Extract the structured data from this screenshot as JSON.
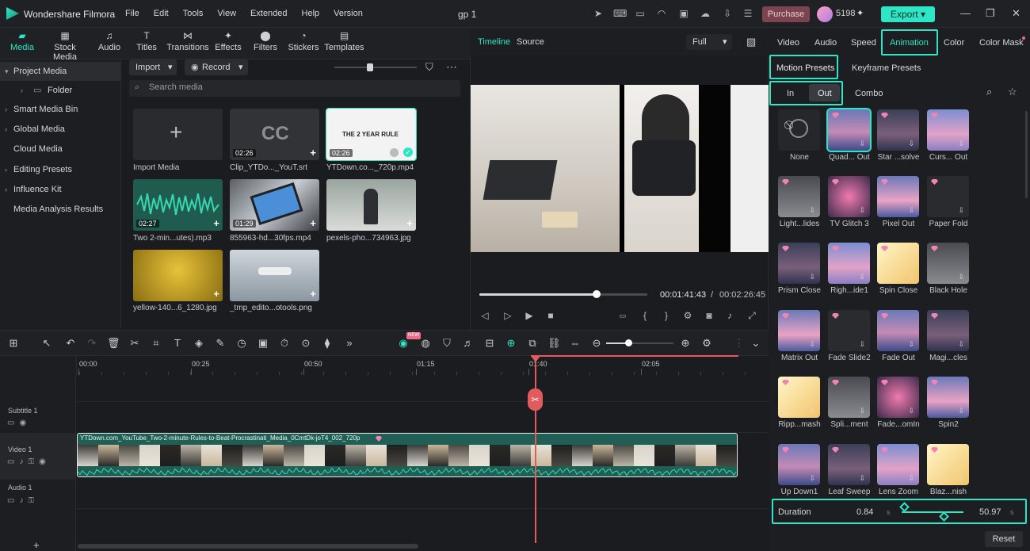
{
  "app": {
    "name": "Wondershare Filmora",
    "project": "gp 1",
    "credits": "5198",
    "purchase": "Purchase",
    "export": "Export"
  },
  "menu": [
    "File",
    "Edit",
    "Tools",
    "View",
    "Extended",
    "Help",
    "Version"
  ],
  "toptabs": [
    {
      "label": "Media",
      "icon": "media-icon"
    },
    {
      "label": "Stock Media",
      "icon": "stock-media-icon"
    },
    {
      "label": "Audio",
      "icon": "audio-icon"
    },
    {
      "label": "Titles",
      "icon": "titles-icon"
    },
    {
      "label": "Transitions",
      "icon": "transitions-icon"
    },
    {
      "label": "Effects",
      "icon": "effects-icon"
    },
    {
      "label": "Filters",
      "icon": "filters-icon"
    },
    {
      "label": "Stickers",
      "icon": "stickers-icon"
    },
    {
      "label": "Templates",
      "icon": "templates-icon"
    }
  ],
  "sidebar": [
    "Project Media",
    "Folder",
    "Smart Media Bin",
    "Global Media",
    "Cloud Media",
    "Editing Presets",
    "Influence Kit",
    "Media Analysis Results"
  ],
  "media_toolbar": {
    "import": "Import",
    "record": "Record",
    "search_placeholder": "Search media"
  },
  "media": [
    {
      "label": "Import Media",
      "duration": ""
    },
    {
      "label": "Clip_YTDo..._YouT.srt",
      "duration": "02:26"
    },
    {
      "label": "YTDown.co..._720p.mp4",
      "duration": "02:26",
      "title_text": "THE 2 YEAR RULE"
    },
    {
      "label": "Two 2-min...utes).mp3",
      "duration": "02:27"
    },
    {
      "label": "855963-hd...30fps.mp4",
      "duration": "01:29"
    },
    {
      "label": "pexels-pho...734963.jpg",
      "duration": ""
    },
    {
      "label": "yellow-140...6_1280.jpg",
      "duration": ""
    },
    {
      "label": "_tmp_edito...otools.png",
      "duration": ""
    }
  ],
  "preview": {
    "tab_timeline": "Timeline",
    "tab_source": "Source",
    "quality": "Full",
    "current": "00:01:41:43",
    "separator": "/",
    "total": "00:02:26:45",
    "progress": 0.7
  },
  "right": {
    "tabs": [
      "Video",
      "Audio",
      "Speed",
      "Animation",
      "Color",
      "Color Mask"
    ],
    "subtabs": [
      "Motion Presets",
      "Keyframe Presets"
    ],
    "inout": [
      "In",
      "Out",
      "Combo"
    ],
    "effects": [
      "None",
      "Quad... Out",
      "Star ...solve",
      "Curs... Out",
      "Light...lides",
      "TV Glitch 3",
      "Pixel Out",
      "Paper Fold",
      "Prism Close",
      "Righ...ide1",
      "Spin Close",
      "Black Hole",
      "Matrix Out",
      "Fade Slide2",
      "Fade Out",
      "Magi...cles",
      "Ripp...mash",
      "Spli...ment",
      "Fade...omIn",
      "Spin2",
      "Up Down1",
      "Leaf Sweep",
      "Lens Zoom",
      "Blaz...nish"
    ],
    "duration_label": "Duration",
    "duration_left": "0.84",
    "duration_right": "50.97",
    "unit_s": "s",
    "reset": "Reset"
  },
  "timeline": {
    "ticks": [
      "00:00",
      "00:25",
      "00:50",
      "01:15",
      "01:40",
      "02:05"
    ],
    "tracks": [
      "Subtitle 1",
      "Video 1",
      "Audio 1"
    ],
    "clip_name": "YTDown.com_YouTube_Two-2-minute-Rules-to-Beat-Procrastinati_Media_0CmtDk-joT4_002_720p",
    "new_badge": "NEW"
  }
}
